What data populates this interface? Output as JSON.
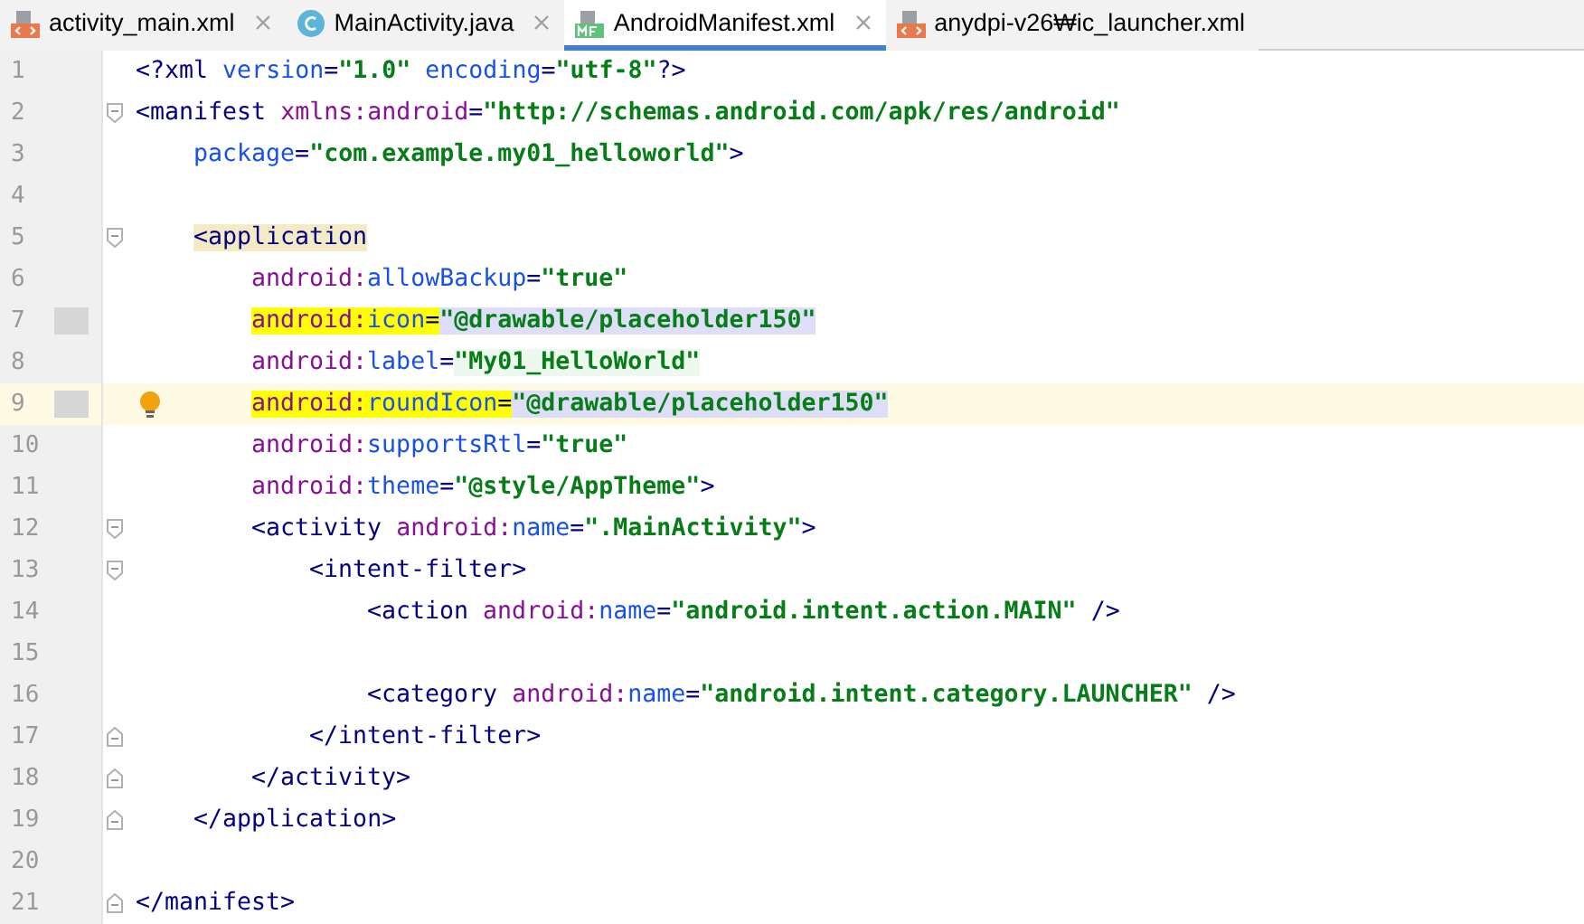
{
  "tabs": [
    {
      "label": "activity_main.xml",
      "kind": "layout",
      "selected": false,
      "closable": true
    },
    {
      "label": "MainActivity.java",
      "kind": "class",
      "selected": false,
      "closable": true
    },
    {
      "label": "AndroidManifest.xml",
      "kind": "manifest",
      "selected": true,
      "closable": true
    },
    {
      "label": "anydpi-v26₩ic_launcher.xml",
      "kind": "layout",
      "selected": false,
      "closable": false
    }
  ],
  "lines": [
    {
      "number": "1",
      "marked": false,
      "current": false,
      "tokens": [
        {
          "text": "<?xml ",
          "kind": "tag"
        },
        {
          "text": "version",
          "kind": "attr"
        },
        {
          "text": "=",
          "kind": "tag"
        },
        {
          "text": "\"1.0\" ",
          "kind": "value"
        },
        {
          "text": "encoding",
          "kind": "attr"
        },
        {
          "text": "=",
          "kind": "tag"
        },
        {
          "text": "\"utf-8\"",
          "kind": "value"
        },
        {
          "text": "?>",
          "kind": "tag"
        }
      ]
    },
    {
      "number": "2",
      "marked": false,
      "current": false,
      "tokens": [
        {
          "text": "<manifest ",
          "kind": "tag"
        },
        {
          "text": "xmlns:android",
          "kind": "ns"
        },
        {
          "text": "=",
          "kind": "tag"
        },
        {
          "text": "\"http://schemas.android.com/apk/res/android\"",
          "kind": "value"
        }
      ],
      "children": [
        {
          "number": "3",
          "marked": false,
          "current": false,
          "tokens": [
            {
              "text": "package",
              "kind": "attr"
            },
            {
              "text": "=",
              "kind": "tag"
            },
            {
              "text": "\"com.example.my01_helloworld\"",
              "kind": "value"
            },
            {
              "text": ">",
              "kind": "tag"
            }
          ]
        },
        {
          "number": "4",
          "marked": false,
          "current": false
        },
        {
          "number": "5",
          "marked": false,
          "current": false,
          "tokens": [
            {
              "text": "<application",
              "kind": "matched"
            }
          ],
          "children": [
            {
              "number": "6",
              "marked": false,
              "current": false,
              "tokens": [
                {
                  "text": "android:",
                  "kind": "ns"
                },
                {
                  "text": "allowBackup",
                  "kind": "attr"
                },
                {
                  "text": "=",
                  "kind": "tag"
                },
                {
                  "text": "\"true\"",
                  "kind": "value"
                }
              ]
            },
            {
              "number": "7",
              "marked": true,
              "current": false,
              "tokens": [
                {
                  "text": "android:",
                  "kind": "ns"
                },
                {
                  "text": "icon",
                  "kind": "attr"
                },
                {
                  "text": "=",
                  "kind": "tag"
                },
                {
                  "text": "\"@drawable/placeholder150\"",
                  "kind": "resource"
                }
              ]
            },
            {
              "number": "8",
              "marked": false,
              "current": false,
              "tokens": [
                {
                  "text": "android:",
                  "kind": "ns"
                },
                {
                  "text": "label",
                  "kind": "attr"
                },
                {
                  "text": "=",
                  "kind": "tag"
                },
                {
                  "text": "\"My01_HelloWorld\"",
                  "kind": "folded"
                }
              ]
            },
            {
              "number": "9",
              "marked": true,
              "current": true,
              "tokens": [
                {
                  "text": "android:",
                  "kind": "ns"
                },
                {
                  "text": "roundIcon",
                  "kind": "attr"
                },
                {
                  "text": "=",
                  "kind": "tag"
                },
                {
                  "text": "\"@drawable/placeholder150\"",
                  "kind": "resource"
                }
              ]
            },
            {
              "number": "10",
              "marked": false,
              "current": false,
              "tokens": [
                {
                  "text": "android:",
                  "kind": "ns"
                },
                {
                  "text": "supportsRtl",
                  "kind": "attr"
                },
                {
                  "text": "=",
                  "kind": "tag"
                },
                {
                  "text": "\"true\"",
                  "kind": "value"
                }
              ]
            },
            {
              "number": "11",
              "marked": false,
              "current": false,
              "tokens": [
                {
                  "text": "android:",
                  "kind": "ns"
                },
                {
                  "text": "theme",
                  "kind": "attr"
                },
                {
                  "text": "=",
                  "kind": "tag"
                },
                {
                  "text": "\"@style/AppTheme\"",
                  "kind": "value"
                },
                {
                  "text": ">",
                  "kind": "tag"
                }
              ]
            },
            {
              "number": "12",
              "marked": false,
              "current": false,
              "tokens": [
                {
                  "text": "<activity ",
                  "kind": "tag"
                },
                {
                  "text": "android:",
                  "kind": "ns"
                },
                {
                  "text": "name",
                  "kind": "attr"
                },
                {
                  "text": "=",
                  "kind": "tag"
                },
                {
                  "text": "\".MainActivity\"",
                  "kind": "value"
                },
                {
                  "text": ">",
                  "kind": "tag"
                }
              ],
              "children": [
                {
                  "number": "13",
                  "marked": false,
                  "current": false,
                  "tokens": [
                    {
                      "text": "<intent-filter>",
                      "kind": "tag"
                    }
                  ],
                  "children": [
                    {
                      "number": "14",
                      "marked": false,
                      "current": false,
                      "tokens": [
                        {
                          "text": "<action ",
                          "kind": "tag"
                        },
                        {
                          "text": "android:",
                          "kind": "ns"
                        },
                        {
                          "text": "name",
                          "kind": "attr"
                        },
                        {
                          "text": "=",
                          "kind": "tag"
                        },
                        {
                          "text": "\"android.intent.action.MAIN\" ",
                          "kind": "value"
                        },
                        {
                          "text": "/>",
                          "kind": "tag"
                        }
                      ]
                    },
                    {
                      "number": "15",
                      "marked": false,
                      "current": false
                    },
                    {
                      "number": "16",
                      "marked": false,
                      "current": false,
                      "tokens": [
                        {
                          "text": "<category ",
                          "kind": "tag"
                        },
                        {
                          "text": "android:",
                          "kind": "ns"
                        },
                        {
                          "text": "name",
                          "kind": "attr"
                        },
                        {
                          "text": "=",
                          "kind": "tag"
                        },
                        {
                          "text": "\"android.intent.category.LAUNCHER\" ",
                          "kind": "value"
                        },
                        {
                          "text": "/>",
                          "kind": "tag"
                        }
                      ]
                    }
                  ],
                  "end": {
                    "number": "17",
                    "marked": false,
                    "current": false,
                    "tokens": [
                      {
                        "text": "</intent-filter>",
                        "kind": "tag"
                      }
                    ]
                  }
                }
              ],
              "end": {
                "number": "18",
                "marked": false,
                "current": false,
                "tokens": [
                  {
                    "text": "</activity>",
                    "kind": "tag"
                  }
                ]
              }
            }
          ],
          "end": {
            "number": "19",
            "marked": false,
            "current": false,
            "tokens": [
              {
                "text": "</application>",
                "kind": "tag"
              }
            ]
          }
        },
        {
          "number": "20",
          "marked": false,
          "current": false
        }
      ],
      "end": {
        "number": "21",
        "marked": false,
        "current": false,
        "tokens": [
          {
            "text": "</manifest>",
            "kind": "tag"
          }
        ]
      }
    }
  ]
}
